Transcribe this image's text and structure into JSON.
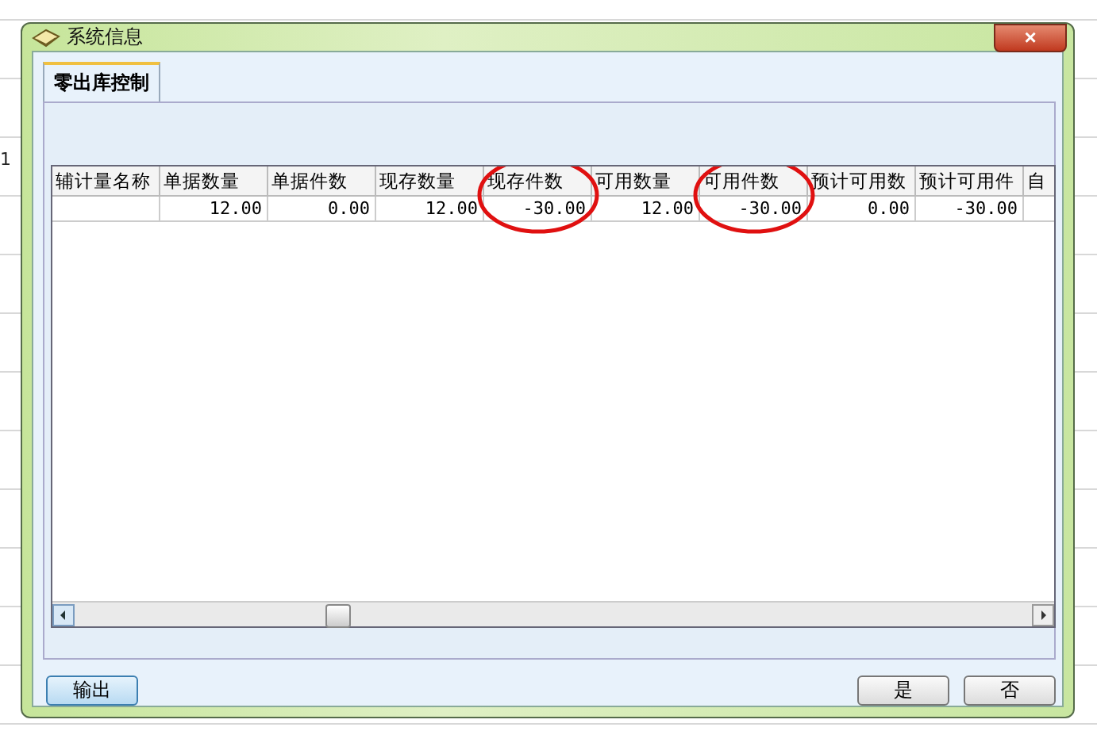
{
  "background": {
    "row_label": "1"
  },
  "window": {
    "title": "系统信息",
    "close": "×"
  },
  "tabs": [
    {
      "label": "零出库控制",
      "selected": true
    }
  ],
  "table": {
    "columns": [
      {
        "label": "辅计量名称",
        "circled": false
      },
      {
        "label": "单据数量",
        "circled": false
      },
      {
        "label": "单据件数",
        "circled": false
      },
      {
        "label": "现存数量",
        "circled": false
      },
      {
        "label": "现存件数",
        "circled": true
      },
      {
        "label": "可用数量",
        "circled": false
      },
      {
        "label": "可用件数",
        "circled": true
      },
      {
        "label": "预计可用数",
        "circled": false
      },
      {
        "label": "预计可用件",
        "circled": false
      },
      {
        "label": "自",
        "circled": false
      }
    ],
    "rows": [
      [
        "",
        "12.00",
        "0.00",
        "12.00",
        "-30.00",
        "12.00",
        "-30.00",
        "0.00",
        "-30.00",
        ""
      ]
    ]
  },
  "buttons": {
    "left": [
      "输出"
    ],
    "right": [
      "是",
      "否"
    ]
  }
}
